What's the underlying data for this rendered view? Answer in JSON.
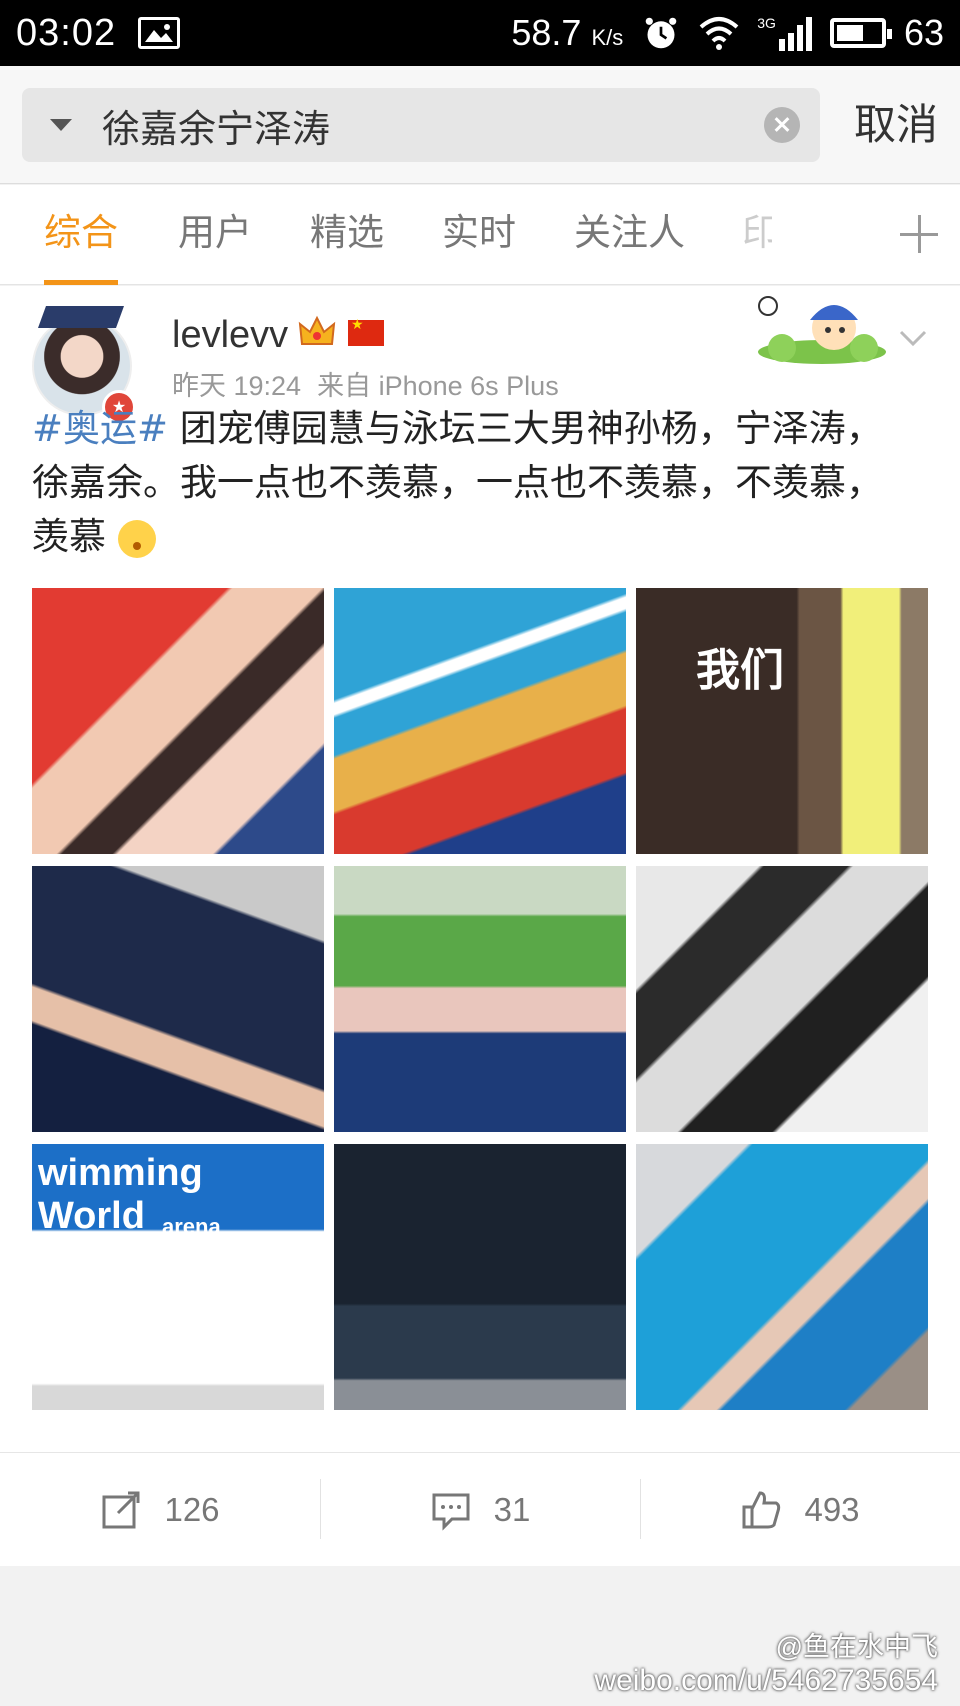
{
  "status_bar": {
    "time": "03:02",
    "speed": "58.7",
    "speed_unit": "K/s",
    "network": "3G",
    "battery": "63",
    "battery_level": 0.63
  },
  "search": {
    "query": "徐嘉余宁泽涛",
    "cancel_label": "取消"
  },
  "tabs": [
    {
      "label": "综合",
      "active": true
    },
    {
      "label": "用户"
    },
    {
      "label": "精选"
    },
    {
      "label": "实时"
    },
    {
      "label": "关注人"
    },
    {
      "label": "印"
    }
  ],
  "post": {
    "username": "levlevv",
    "timestamp": "昨天 19:24",
    "source": "来自 iPhone 6s Plus",
    "hashtag": "#奥运#",
    "text": " 团宠傅园慧与泳坛三大男神孙杨，宁泽涛，徐嘉余。我一点也不羡慕，一点也不羡慕，不羡慕，羡慕",
    "photo_captions": {
      "p3": "我们",
      "p7_banner": "wimming World",
      "p7_sponsor": "arena"
    },
    "actions": {
      "repost_count": "126",
      "comment_count": "31",
      "like_count": "493"
    }
  },
  "watermark": {
    "handle": "@鱼在水中飞",
    "url": "weibo.com/u/5462735654"
  },
  "colors": {
    "accent": "#f39418",
    "hashtag": "#4a7fbf"
  }
}
